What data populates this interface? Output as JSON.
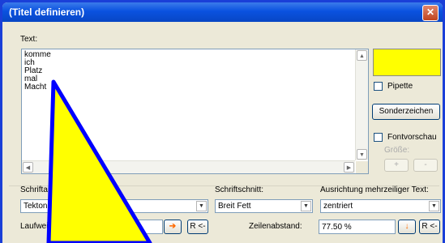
{
  "window": {
    "title": "(Titel definieren)",
    "close_glyph": "✕"
  },
  "text_section": {
    "label": "Text:",
    "content": "komme\nich\nPlatz\nmal\nMacht"
  },
  "right_panel": {
    "color_swatch": "#ffff00",
    "pipette_label": "Pipette",
    "special_chars_label": "Sonderzeichen",
    "font_preview_label": "Fontvorschau",
    "size_label": "Größe:",
    "plus_label": "+",
    "minus_label": "-"
  },
  "font": {
    "label": "Schriftart:",
    "value": "Tekton Pro",
    "tracking_label": "Laufweite:",
    "tracking_reset": "R <-"
  },
  "style": {
    "label": "Schriftschnitt:",
    "value": "Breit Fett",
    "line_spacing_label": "Zeilenabstand:",
    "line_spacing_value": "77.50 %",
    "line_spacing_reset": "R <-"
  },
  "alignment": {
    "label": "Ausrichtung mehrzeiliger Text:",
    "value": "zentriert"
  },
  "scroll": {
    "up": "▲",
    "down": "▼",
    "left": "◀",
    "right": "▶",
    "combo_arrow": "▼"
  },
  "colors": {
    "overlay_fill": "#ffff00",
    "overlay_stroke": "#0000ff",
    "arrow_orange": "#ff6a00"
  }
}
